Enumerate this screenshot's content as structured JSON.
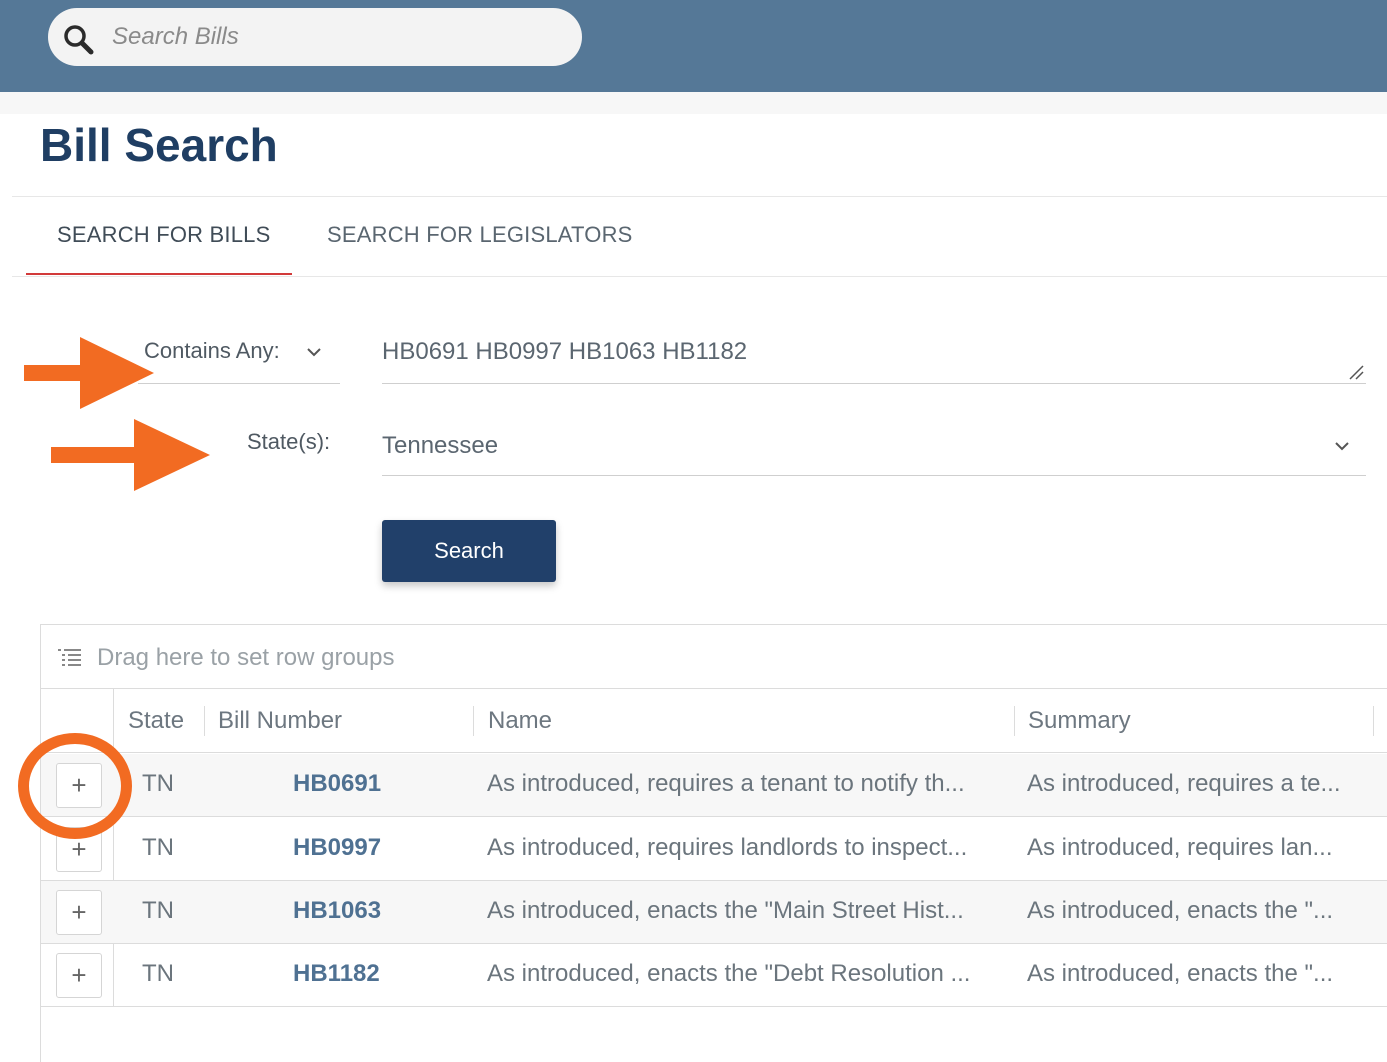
{
  "topbar": {
    "search_placeholder": "Search Bills",
    "search_icon": "search-icon",
    "color": "#557897"
  },
  "page": {
    "title": "Bill Search",
    "title_color": "#1f3e63"
  },
  "tabs": [
    {
      "label": "SEARCH FOR BILLS",
      "active": true
    },
    {
      "label": "SEARCH FOR LEGISLATORS",
      "active": false
    }
  ],
  "form": {
    "match_mode_label": "Contains Any:",
    "keywords_value": "HB0691 HB0997 HB1063 HB1182",
    "states_label": "State(s):",
    "states_value": "Tennessee",
    "search_button_label": "Search",
    "button_color": "#21406a"
  },
  "annotations": {
    "arrow_color": "#f26b22",
    "circle_color": "#f26b22"
  },
  "grid": {
    "group_drop_text": "Drag here to set row groups",
    "columns": [
      "State",
      "Bill Number",
      "Name",
      "Summary"
    ],
    "rows": [
      {
        "expand": "+",
        "state": "TN",
        "bill_number": "HB0691",
        "name": "As introduced, requires a tenant to notify th...",
        "summary": "As introduced, requires a te..."
      },
      {
        "expand": "+",
        "state": "TN",
        "bill_number": "HB0997",
        "name": "As introduced, requires landlords to inspect...",
        "summary": "As introduced, requires lan..."
      },
      {
        "expand": "+",
        "state": "TN",
        "bill_number": "HB1063",
        "name": "As introduced, enacts the \"Main Street Hist...",
        "summary": "As introduced, enacts the \"..."
      },
      {
        "expand": "+",
        "state": "TN",
        "bill_number": "HB1182",
        "name": "As introduced, enacts the \"Debt Resolution ...",
        "summary": "As introduced, enacts the \"..."
      }
    ]
  }
}
